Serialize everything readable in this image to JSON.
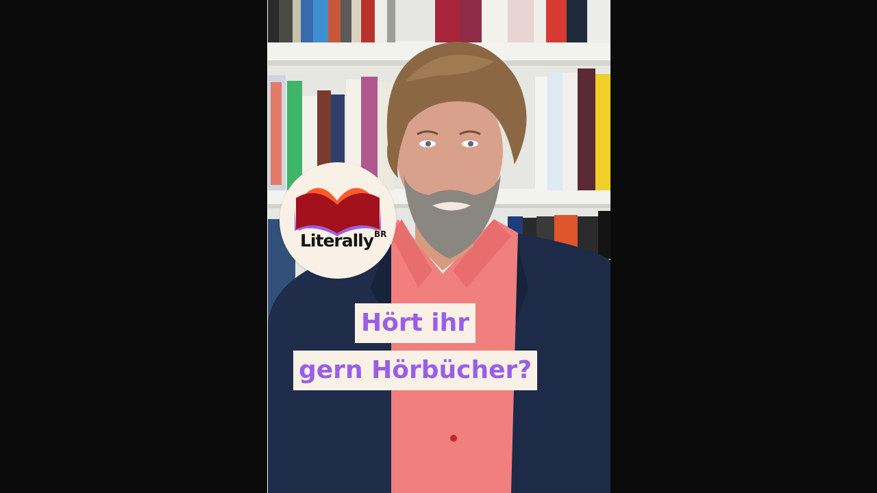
{
  "logo": {
    "wordmark": "Literally",
    "brand_mark": "BR",
    "icon": "open-book-icon",
    "colors": {
      "badge_background": "#faf1e6",
      "book_red": "#b0151a",
      "book_orange": "#ff5a2a",
      "book_purple": "#9a5ee6"
    }
  },
  "caption": {
    "line1": "Hört ihr",
    "line2": "gern Hörbücher?",
    "text_color": "#9a5ee6",
    "box_color": "#faf1e6"
  }
}
